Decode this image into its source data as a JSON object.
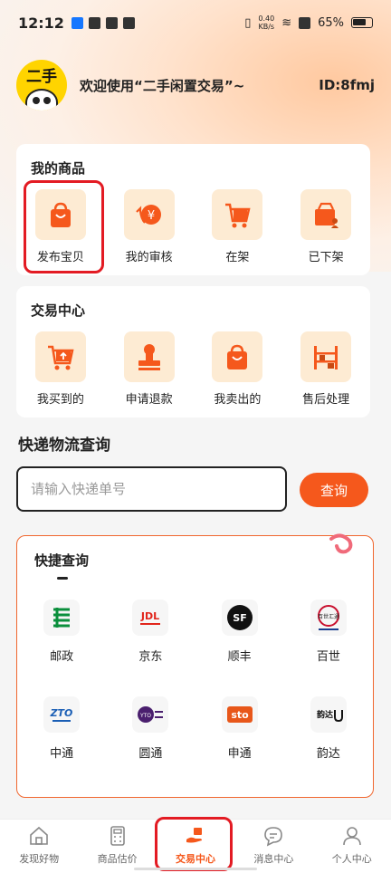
{
  "status_bar": {
    "time": "12:12",
    "net_speed_value": "0.40",
    "net_speed_unit": "KB/s",
    "battery": "65%"
  },
  "header": {
    "avatar_text": "二手",
    "welcome": "欢迎使用“二手闲置交易”~",
    "user_id": "ID:8fmj"
  },
  "my_goods": {
    "title": "我的商品",
    "items": [
      {
        "label": "发布宝贝",
        "icon": "shopping-bag-icon"
      },
      {
        "label": "我的审核",
        "icon": "yen-refresh-icon"
      },
      {
        "label": "在架",
        "icon": "shopping-cart-icon"
      },
      {
        "label": "已下架",
        "icon": "box-person-icon"
      }
    ]
  },
  "trade_center": {
    "title": "交易中心",
    "items": [
      {
        "label": "我买到的",
        "icon": "cart-upload-icon"
      },
      {
        "label": "申请退款",
        "icon": "stamp-icon"
      },
      {
        "label": "我卖出的",
        "icon": "shopping-bag-icon"
      },
      {
        "label": "售后处理",
        "icon": "warehouse-shelf-icon"
      }
    ]
  },
  "logistics": {
    "title": "快递物流查询",
    "placeholder": "请输入快递单号",
    "button": "查询"
  },
  "quick_query": {
    "title": "快捷查询",
    "couriers": [
      {
        "label": "邮政",
        "logo_text": ""
      },
      {
        "label": "京东",
        "logo_text": "JDL"
      },
      {
        "label": "顺丰",
        "logo_text": "SF"
      },
      {
        "label": "百世",
        "logo_text": "百世汇通"
      },
      {
        "label": "中通",
        "logo_text": "ZTO"
      },
      {
        "label": "圆通",
        "logo_text": "YTO"
      },
      {
        "label": "申通",
        "logo_text": "sto"
      },
      {
        "label": "韵达",
        "logo_text": "韵达"
      }
    ]
  },
  "bottom_nav": {
    "items": [
      {
        "label": "发现好物",
        "icon": "home-icon",
        "active": false
      },
      {
        "label": "商品估价",
        "icon": "calculator-icon",
        "active": false
      },
      {
        "label": "交易中心",
        "icon": "hand-box-icon",
        "active": true
      },
      {
        "label": "消息中心",
        "icon": "chat-bubble-icon",
        "active": false
      },
      {
        "label": "个人中心",
        "icon": "person-icon",
        "active": false
      }
    ]
  },
  "colors": {
    "accent": "#f5581c",
    "tile_bg": "#fdebd3",
    "highlight": "#e31b23"
  }
}
